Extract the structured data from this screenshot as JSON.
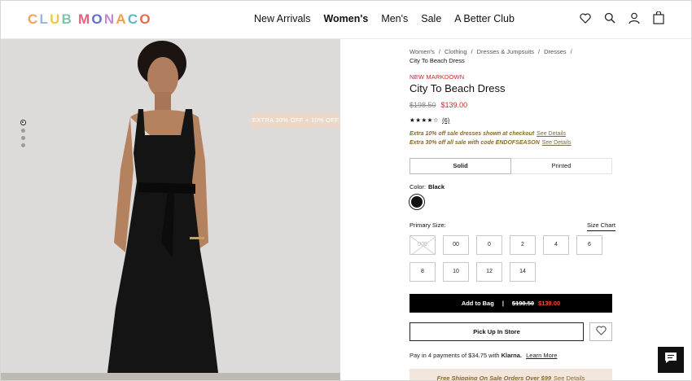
{
  "header": {
    "logo_letters": [
      "C",
      "L",
      "U",
      "B",
      " ",
      "M",
      "O",
      "N",
      "A",
      "C",
      "O"
    ],
    "logo_colors": [
      "#f0a35c",
      "#9bb3e6",
      "#f2c64a",
      "#7fc4a8",
      "#ffffff",
      "#e8607a",
      "#5b6fd6",
      "#c48ad6",
      "#f2a04a",
      "#58b7c9",
      "#e96a4a"
    ],
    "nav": [
      {
        "label": "New Arrivals",
        "active": false
      },
      {
        "label": "Women's",
        "active": true
      },
      {
        "label": "Men's",
        "active": false
      },
      {
        "label": "Sale",
        "active": false
      },
      {
        "label": "A Better Club",
        "active": false
      }
    ],
    "icons": [
      "heart-icon",
      "search-icon",
      "account-icon",
      "bag-icon"
    ]
  },
  "gallery": {
    "promo_label": "EXTRA 30% OFF + 10% OFF",
    "dot_count": 4,
    "active_dot": 0
  },
  "product": {
    "breadcrumbs": [
      "Women's",
      "Clothing",
      "Dresses & Jumpsuits",
      "Dresses"
    ],
    "breadcrumb_current": "City To Beach Dress",
    "badge": "NEW MARKDOWN",
    "title": "City To Beach Dress",
    "price_original": "$198.50",
    "price_sale": "$139.00",
    "stars": "★★★★☆",
    "rating_value": 4,
    "review_count": "(6)",
    "offers": [
      {
        "text": "Extra 10% off sale dresses shown at checkout",
        "link": "See Details"
      },
      {
        "text": "Extra 30% off all sale with code ENDOFSEASON",
        "link": "See Details"
      }
    ],
    "pattern_tabs": [
      {
        "label": "Solid",
        "active": true
      },
      {
        "label": "Printed",
        "active": false
      }
    ],
    "color_label": "Color:",
    "color_value": "Black",
    "swatch_color": "#111111",
    "size_label": "Primary Size:",
    "size_chart_label": "Size Chart",
    "sizes": [
      {
        "label": "000",
        "available": false
      },
      {
        "label": "00",
        "available": true
      },
      {
        "label": "0",
        "available": true
      },
      {
        "label": "2",
        "available": true
      },
      {
        "label": "4",
        "available": true
      },
      {
        "label": "6",
        "available": true
      },
      {
        "label": "8",
        "available": true
      },
      {
        "label": "10",
        "available": true
      },
      {
        "label": "12",
        "available": true
      },
      {
        "label": "14",
        "available": true
      }
    ],
    "add_to_bag": {
      "label": "Add to Bag",
      "separator": "|",
      "old": "$198.50",
      "new": "$139.00"
    },
    "pickup_label": "Pick Up In Store",
    "klarna": {
      "prefix": "Pay in 4 payments of $34.75 with",
      "brand": "Klarna.",
      "link": "Learn More"
    },
    "shipping": {
      "text": "Free Shipping On Sale Orders Over $99",
      "link": "See Details"
    }
  },
  "colors": {
    "accent_red": "#c8281e",
    "promo_gold": "#8a6a2a",
    "promo_bg": "#ecd8c8"
  }
}
